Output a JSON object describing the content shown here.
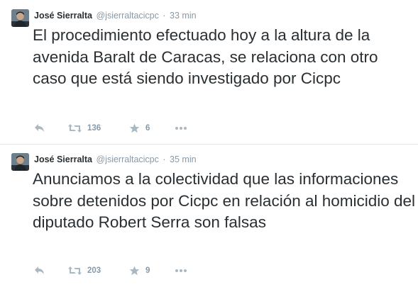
{
  "tweets": [
    {
      "fullname": "José Sierralta",
      "username": "@jsierraltacicpc",
      "separator": "·",
      "time": "33 min",
      "text": "El procedimiento efectuado hoy a la altura de la avenida Baralt de Caracas, se relaciona con otro caso que está siendo investigado por Cicpc",
      "retweets": "136",
      "favorites": "6",
      "icons": [
        "reply-icon",
        "retweet-icon",
        "favorite-icon",
        "more-icon"
      ]
    },
    {
      "fullname": "José Sierralta",
      "username": "@jsierraltacicpc",
      "separator": "·",
      "time": "35 min",
      "text": "Anunciamos a la colectividad que las informaciones sobre detenidos por Cicpc en relación al homicidio del diputado Robert Serra son falsas",
      "retweets": "203",
      "favorites": "9",
      "icons": [
        "reply-icon",
        "retweet-icon",
        "favorite-icon",
        "more-icon"
      ]
    }
  ],
  "colors": {
    "text": "#292f33",
    "muted": "#8899a6",
    "icon": "#aab8c2",
    "divider": "#e1e8ed"
  }
}
